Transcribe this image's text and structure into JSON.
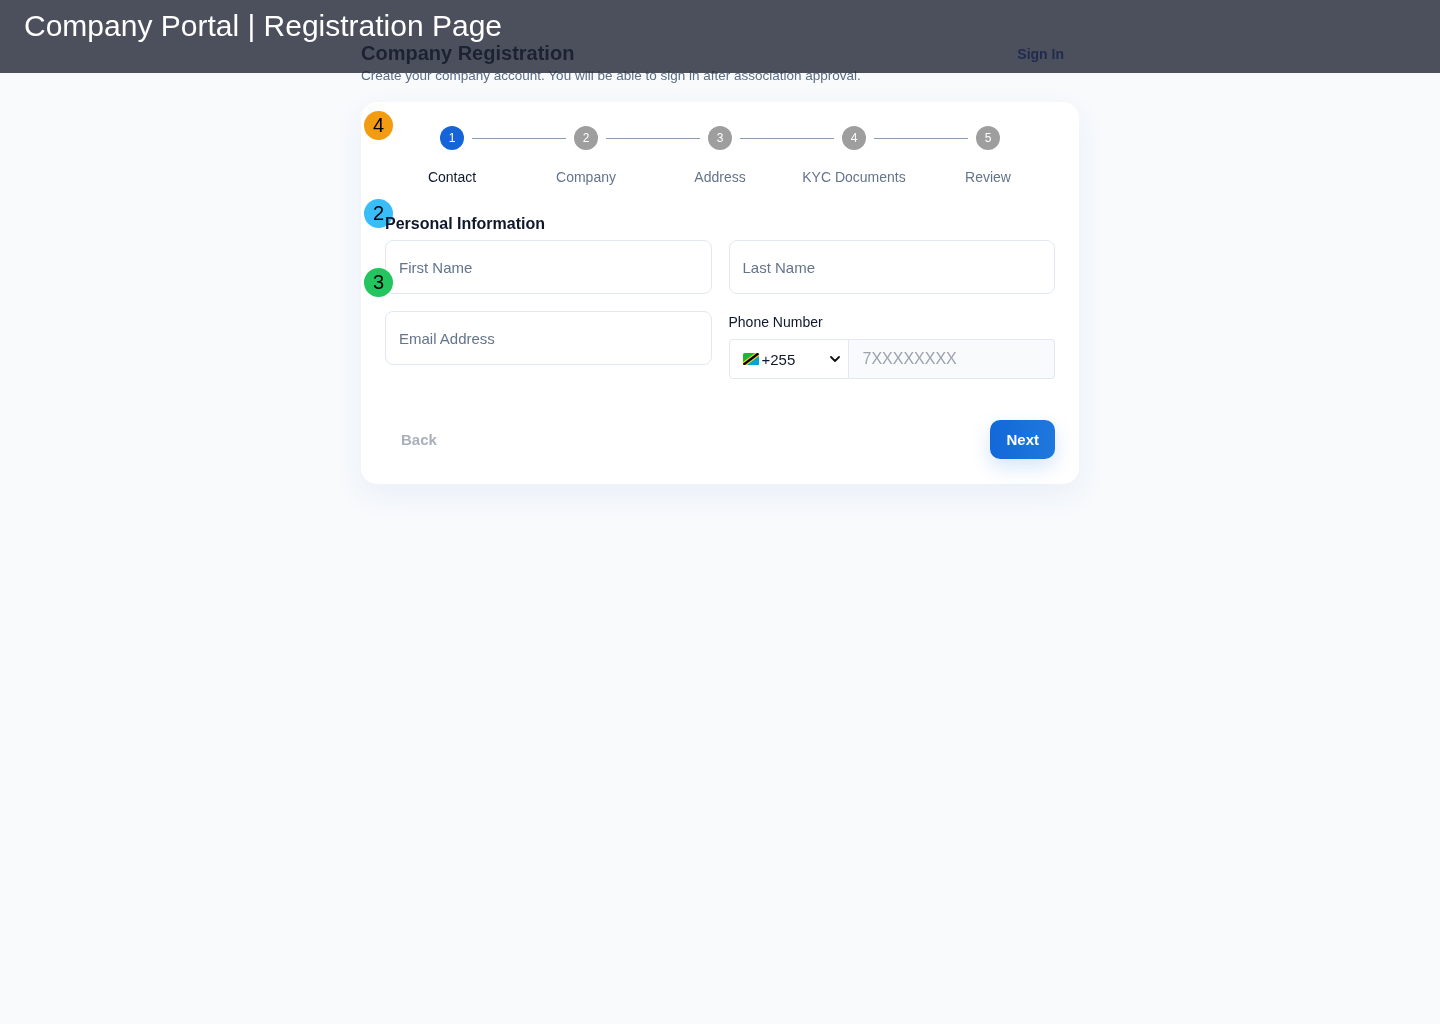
{
  "overlay_bar": {
    "title": "Company Portal | Registration Page"
  },
  "header": {
    "title": "Company Registration",
    "subtitle": "Create your company account. You will be able to sign in after association approval.",
    "sign_in_link": "Sign In"
  },
  "stepper": {
    "marker": {
      "label": "4",
      "color": "#f39c12"
    },
    "steps": [
      {
        "number": "1",
        "label": "Contact",
        "selected": true
      },
      {
        "number": "2",
        "label": "Company",
        "selected": false
      },
      {
        "number": "3",
        "label": "Address",
        "selected": false
      },
      {
        "number": "4",
        "label": "KYC Documents",
        "selected": false
      },
      {
        "number": "5",
        "label": "Review",
        "selected": false
      }
    ]
  },
  "section": {
    "title": "Personal Information",
    "marker": {
      "label": "2",
      "color": "#38bdf8"
    }
  },
  "fields": [
    {
      "kind": "text",
      "placeholder": "First Name",
      "marker": {
        "label": "3",
        "color": "#22c55e"
      }
    },
    {
      "kind": "text",
      "placeholder": "Last Name"
    },
    {
      "kind": "text",
      "placeholder": "Email Address"
    },
    {
      "kind": "phone",
      "label": "Phone Number",
      "country_code": "+255",
      "placeholder": "7XXXXXXXX"
    }
  ],
  "buttons": [
    {
      "kind": "secondary",
      "label": "Back",
      "disabled": true
    },
    {
      "kind": "primary",
      "label": "Next",
      "disabled": false
    }
  ]
}
